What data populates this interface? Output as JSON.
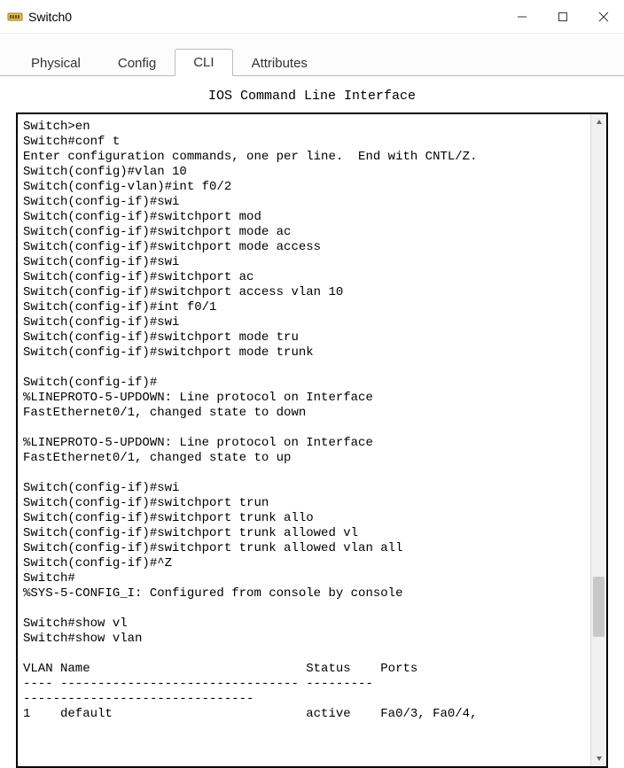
{
  "window": {
    "title": "Switch0"
  },
  "tabs": {
    "t0": "Physical",
    "t1": "Config",
    "t2": "CLI",
    "t3": "Attributes"
  },
  "subtitle": "IOS Command Line Interface",
  "cli_output": "Switch>en\nSwitch#conf t\nEnter configuration commands, one per line.  End with CNTL/Z.\nSwitch(config)#vlan 10\nSwitch(config-vlan)#int f0/2\nSwitch(config-if)#swi\nSwitch(config-if)#switchport mod\nSwitch(config-if)#switchport mode ac\nSwitch(config-if)#switchport mode access\nSwitch(config-if)#swi\nSwitch(config-if)#switchport ac\nSwitch(config-if)#switchport access vlan 10\nSwitch(config-if)#int f0/1\nSwitch(config-if)#swi\nSwitch(config-if)#switchport mode tru\nSwitch(config-if)#switchport mode trunk\n\nSwitch(config-if)#\n%LINEPROTO-5-UPDOWN: Line protocol on Interface\nFastEthernet0/1, changed state to down\n\n%LINEPROTO-5-UPDOWN: Line protocol on Interface\nFastEthernet0/1, changed state to up\n\nSwitch(config-if)#swi\nSwitch(config-if)#switchport trun\nSwitch(config-if)#switchport trunk allo\nSwitch(config-if)#switchport trunk allowed vl\nSwitch(config-if)#switchport trunk allowed vlan all\nSwitch(config-if)#^Z\nSwitch#\n%SYS-5-CONFIG_I: Configured from console by console\n\nSwitch#show vl\nSwitch#show vlan\n\nVLAN Name                             Status    Ports\n---- -------------------------------- --------- \n-------------------------------\n1    default                          active    Fa0/3, Fa0/4,"
}
